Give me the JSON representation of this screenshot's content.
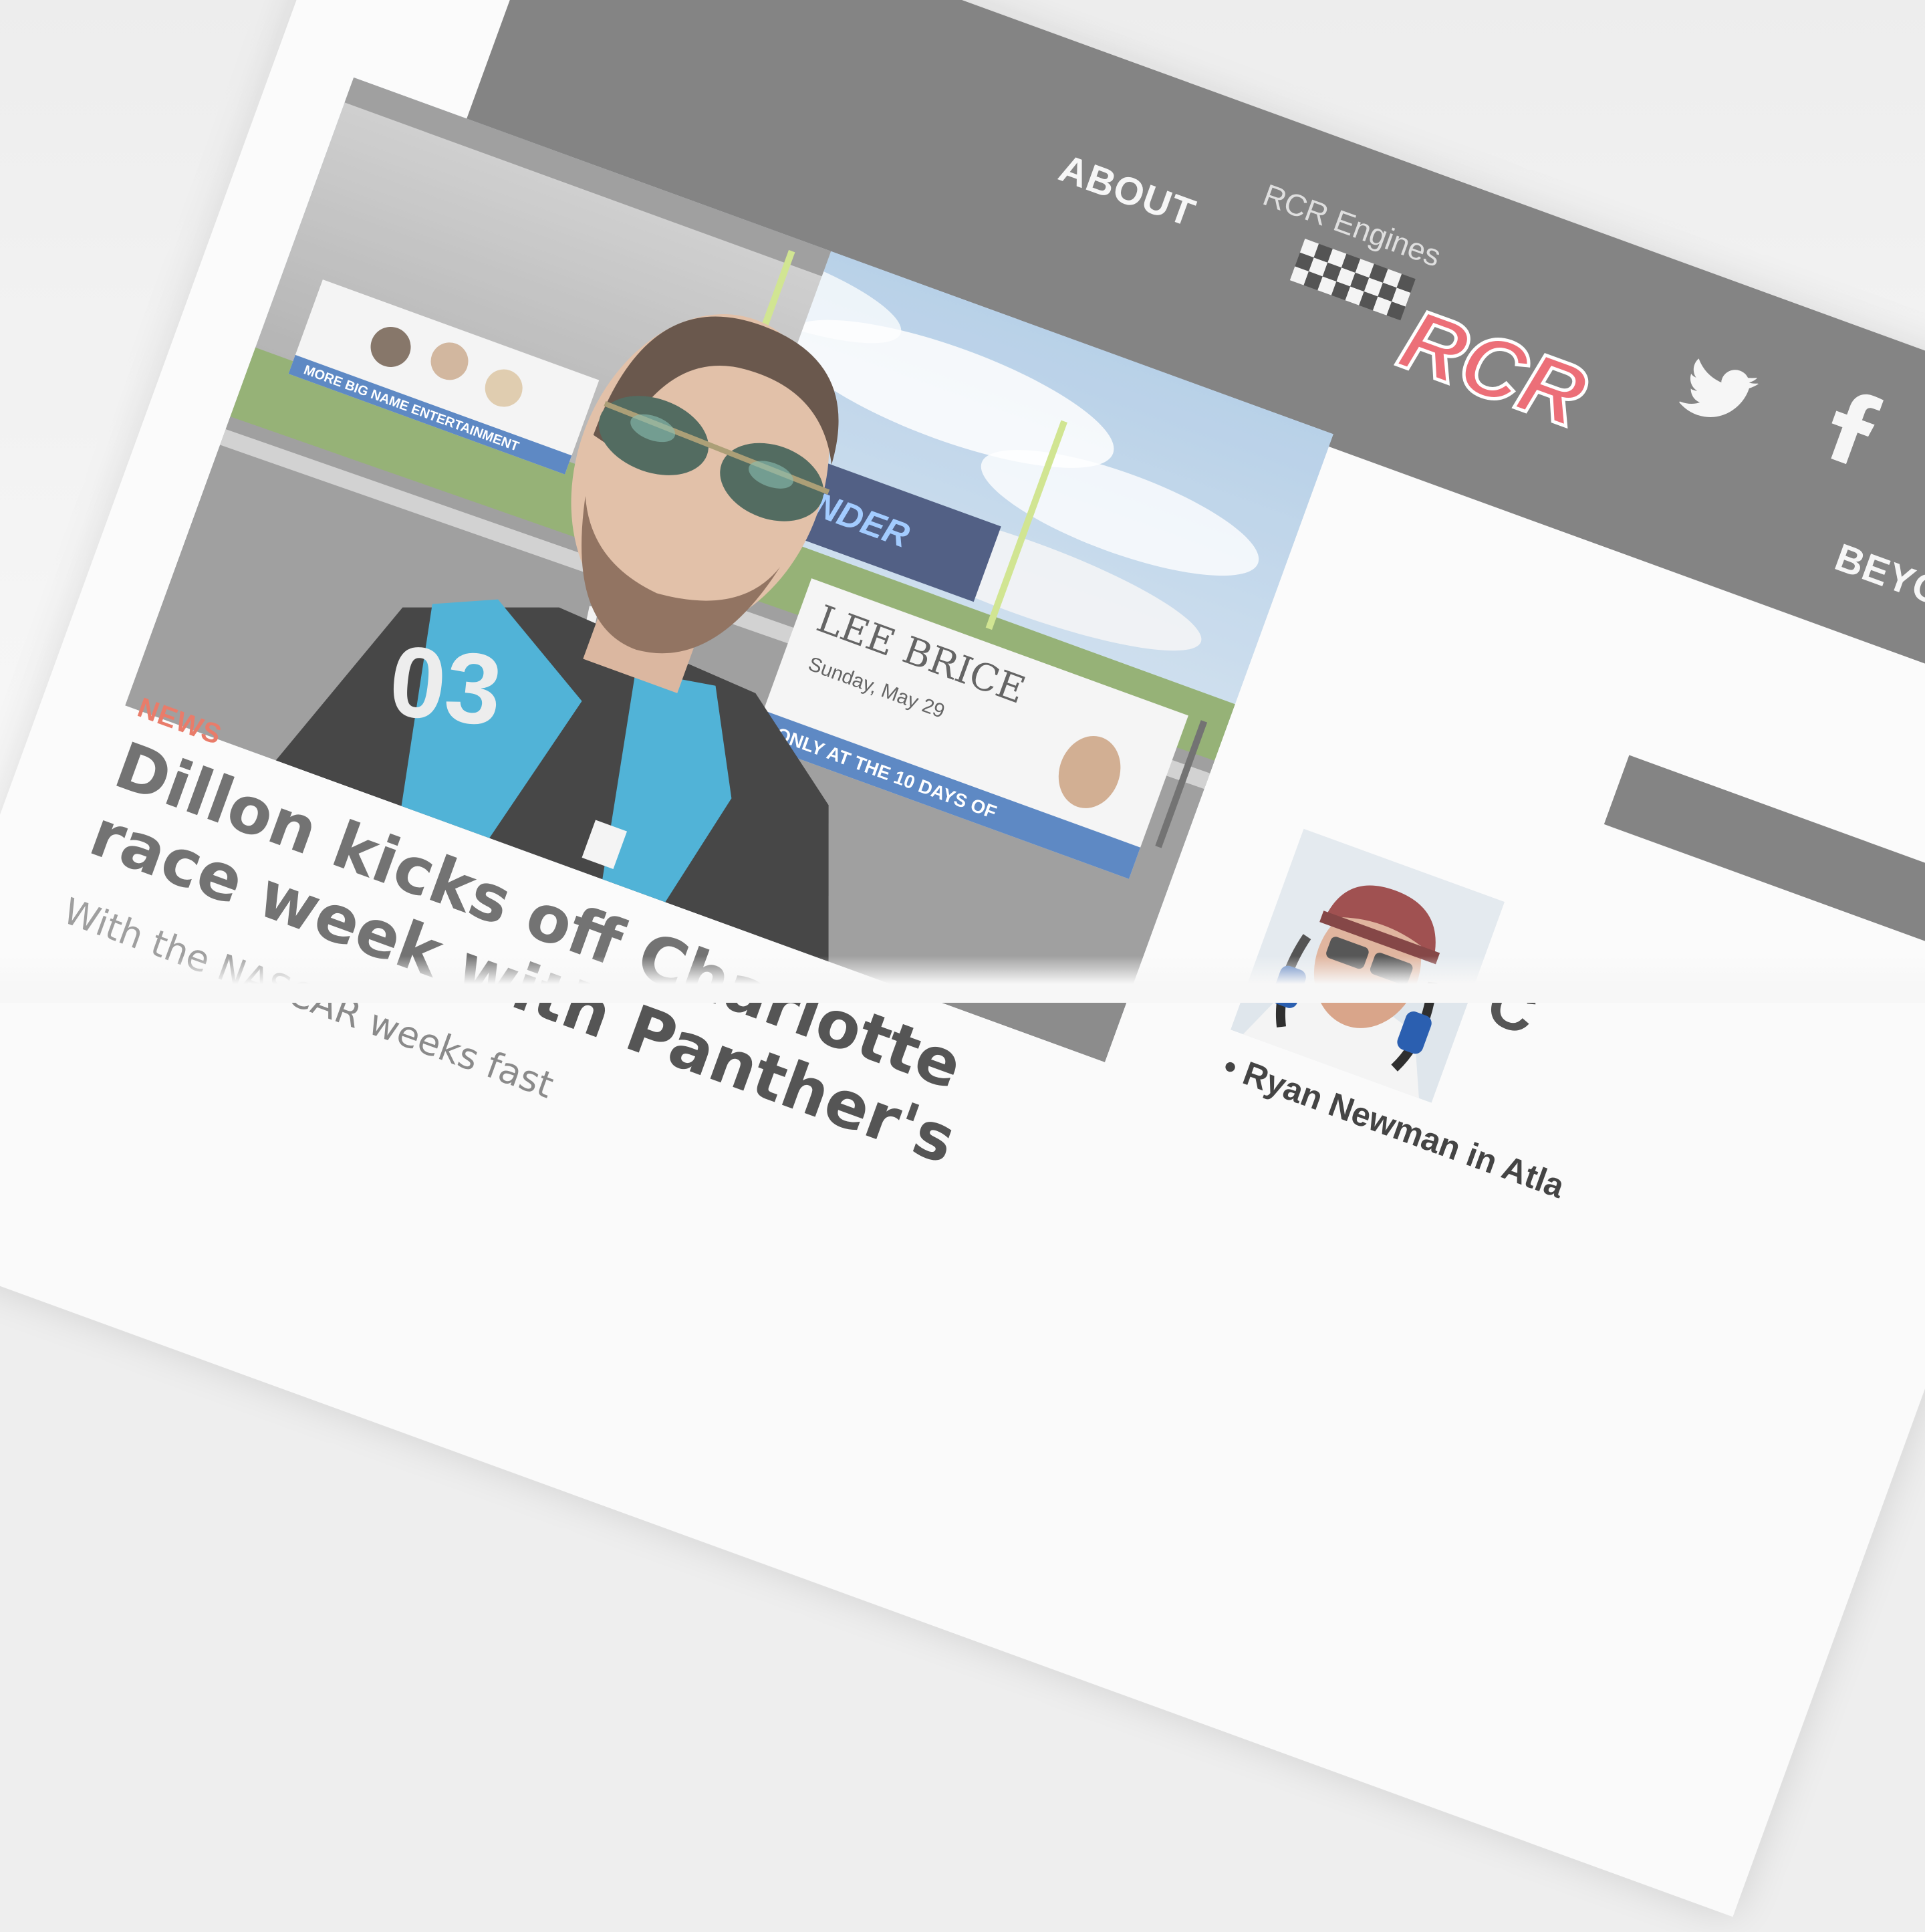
{
  "header": {
    "top_link": "RCR Engines",
    "nav": [
      {
        "label": "ABOUT"
      },
      {
        "label": "BEYOND THE TRACK"
      }
    ],
    "logo_text": "RCR",
    "social": [
      "twitter-icon",
      "facebook-icon"
    ],
    "colors": {
      "bar": "#6a6a6a",
      "logo_red": "#e8505b"
    }
  },
  "featured": {
    "category": "NEWS",
    "headline": "Dillon kicks off Charlotte race week with Panther's",
    "excerpt": "With the NASCAR weeks fast",
    "photo_signs": {
      "banner_name": "LEE BRICE",
      "banner_date": "Sunday, May 29",
      "banner_strip": "ONLY AT THE 10 DAYS OF",
      "left_strip": "MORE BIG NAME ENTERTAINMENT",
      "thunder_sign": "THUNDER",
      "jersey_number": "03"
    }
  },
  "sidebar": {
    "headline": "C",
    "link": "• Ryan Newman in Atla"
  }
}
